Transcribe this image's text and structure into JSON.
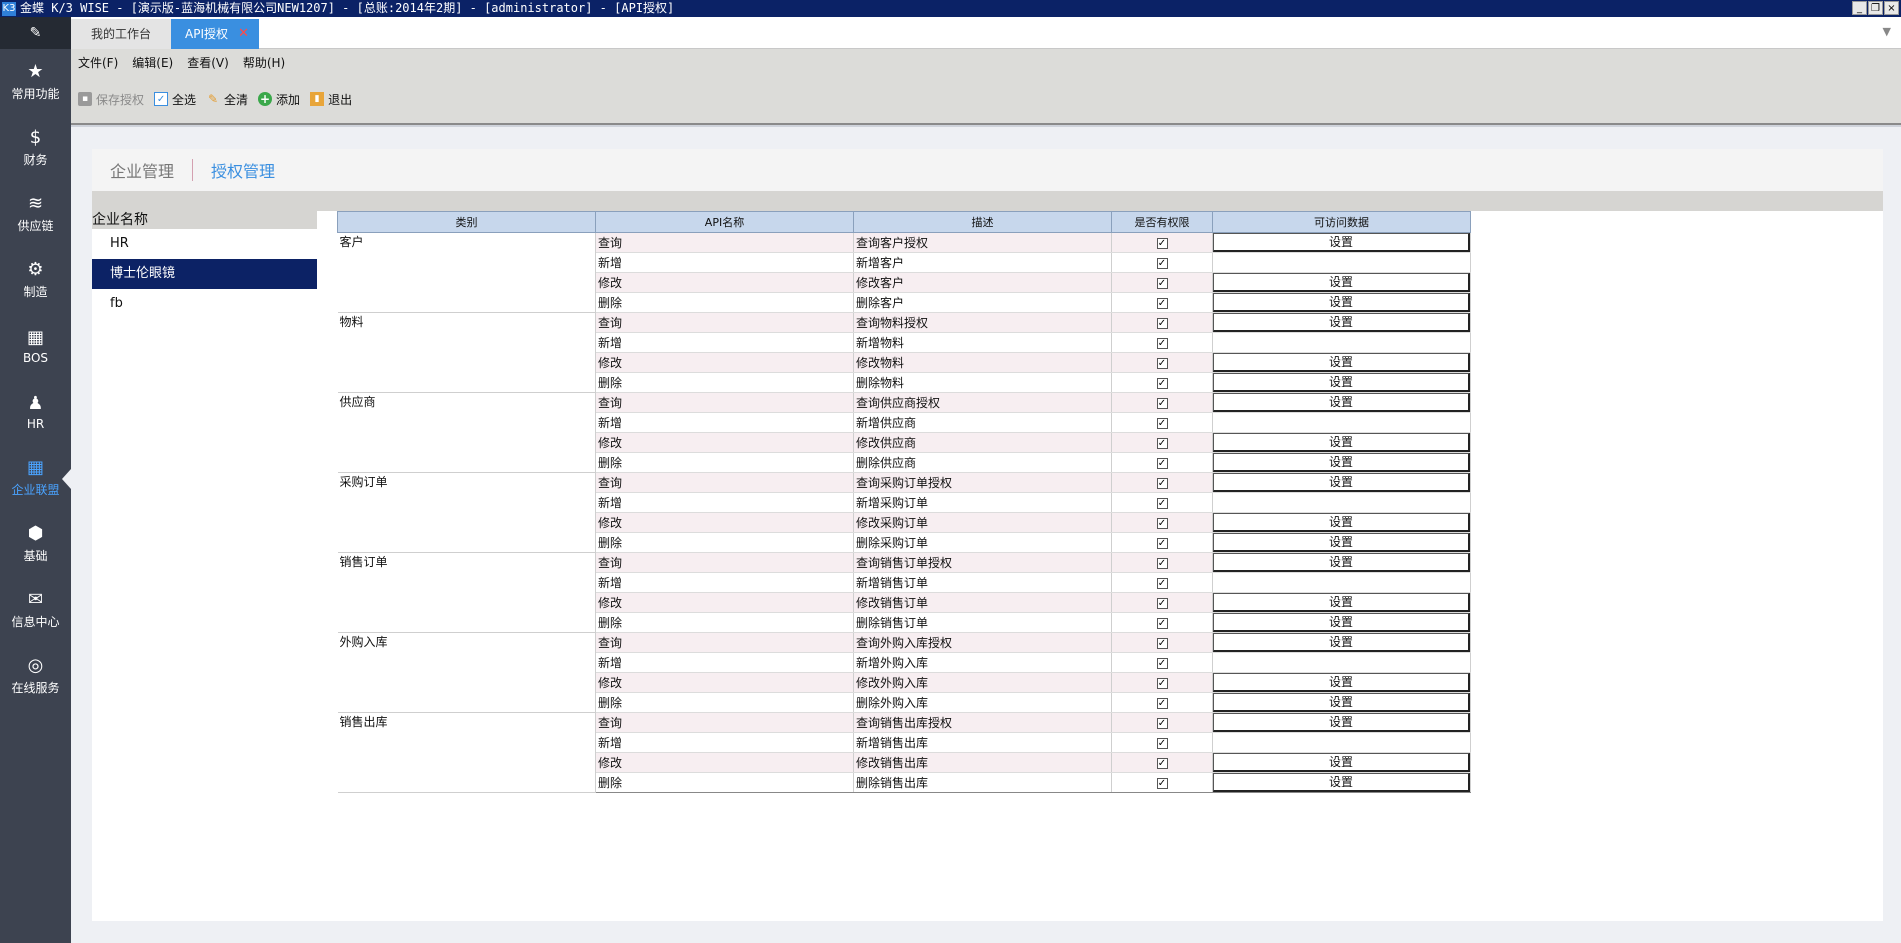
{
  "window": {
    "logo": "K3",
    "title": "金蝶 K/3 WISE - [演示版-蓝海机械有限公司NEW1207] - [总账:2014年2期] - [administrator] - [API授权]",
    "btn_min": "_",
    "btn_restore": "❐",
    "btn_close": "×"
  },
  "sidebar": {
    "edit_icon": "✎",
    "items": [
      {
        "label": "常用功能",
        "icon": "★",
        "icon_name": "star-icon"
      },
      {
        "label": "财务",
        "icon": "$",
        "icon_name": "dollar-icon"
      },
      {
        "label": "供应链",
        "icon": "≋",
        "icon_name": "database-icon"
      },
      {
        "label": "制造",
        "icon": "⚙",
        "icon_name": "gear-icon"
      },
      {
        "label": "BOS",
        "icon": "▦",
        "icon_name": "grid-icon"
      },
      {
        "label": "HR",
        "icon": "♟",
        "icon_name": "people-icon"
      },
      {
        "label": "企业联盟",
        "icon": "▦",
        "icon_name": "blocks-icon"
      },
      {
        "label": "基础",
        "icon": "⬢",
        "icon_name": "hexagon-icon"
      },
      {
        "label": "信息中心",
        "icon": "✉",
        "icon_name": "mail-icon"
      },
      {
        "label": "在线服务",
        "icon": "◎",
        "icon_name": "service-icon"
      }
    ],
    "active_index": 6
  },
  "tabs": {
    "workspace": "我的工作台",
    "active": "API授权",
    "close_glyph": "✕",
    "dropdown_glyph": "▼"
  },
  "menu": [
    "文件(F)",
    "编辑(E)",
    "查看(V)",
    "帮助(H)"
  ],
  "toolbar": {
    "save": "保存授权",
    "select_all": "全选",
    "clear_all": "全清",
    "add": "添加",
    "exit": "退出",
    "glyph_save": "▪",
    "glyph_select_all": "✓",
    "glyph_clear_all": "✎",
    "glyph_add": "+",
    "glyph_exit": "▮"
  },
  "subtabs": {
    "enterprise": "企业管理",
    "authorization": "授权管理"
  },
  "enterprise": {
    "title": "企业名称",
    "items": [
      "HR",
      "博士伦眼镜",
      "fb"
    ],
    "selected_index": 1
  },
  "grid": {
    "columns": [
      "类别",
      "API名称",
      "描述",
      "是否有权限",
      "可访问数据"
    ],
    "check_glyph": "✓",
    "button_label": "设置",
    "groups": [
      {
        "category": "客户",
        "rows": [
          {
            "api": "查询",
            "desc": "查询客户授权",
            "checked": true,
            "button": true
          },
          {
            "api": "新增",
            "desc": "新增客户",
            "checked": true,
            "button": false
          },
          {
            "api": "修改",
            "desc": "修改客户",
            "checked": true,
            "button": true
          },
          {
            "api": "删除",
            "desc": "删除客户",
            "checked": true,
            "button": true
          }
        ]
      },
      {
        "category": "物料",
        "rows": [
          {
            "api": "查询",
            "desc": "查询物料授权",
            "checked": true,
            "button": true
          },
          {
            "api": "新增",
            "desc": "新增物料",
            "checked": true,
            "button": false
          },
          {
            "api": "修改",
            "desc": "修改物料",
            "checked": true,
            "button": true
          },
          {
            "api": "删除",
            "desc": "删除物料",
            "checked": true,
            "button": true
          }
        ]
      },
      {
        "category": "供应商",
        "rows": [
          {
            "api": "查询",
            "desc": "查询供应商授权",
            "checked": true,
            "button": true
          },
          {
            "api": "新增",
            "desc": "新增供应商",
            "checked": true,
            "button": false
          },
          {
            "api": "修改",
            "desc": "修改供应商",
            "checked": true,
            "button": true
          },
          {
            "api": "删除",
            "desc": "删除供应商",
            "checked": true,
            "button": true
          }
        ]
      },
      {
        "category": "采购订单",
        "rows": [
          {
            "api": "查询",
            "desc": "查询采购订单授权",
            "checked": true,
            "button": true
          },
          {
            "api": "新增",
            "desc": "新增采购订单",
            "checked": true,
            "button": false
          },
          {
            "api": "修改",
            "desc": "修改采购订单",
            "checked": true,
            "button": true
          },
          {
            "api": "删除",
            "desc": "删除采购订单",
            "checked": true,
            "button": true
          }
        ]
      },
      {
        "category": "销售订单",
        "rows": [
          {
            "api": "查询",
            "desc": "查询销售订单授权",
            "checked": true,
            "button": true
          },
          {
            "api": "新增",
            "desc": "新增销售订单",
            "checked": true,
            "button": false
          },
          {
            "api": "修改",
            "desc": "修改销售订单",
            "checked": true,
            "button": true
          },
          {
            "api": "删除",
            "desc": "删除销售订单",
            "checked": true,
            "button": true
          }
        ]
      },
      {
        "category": "外购入库",
        "rows": [
          {
            "api": "查询",
            "desc": "查询外购入库授权",
            "checked": true,
            "button": true
          },
          {
            "api": "新增",
            "desc": "新增外购入库",
            "checked": true,
            "button": false
          },
          {
            "api": "修改",
            "desc": "修改外购入库",
            "checked": true,
            "button": true
          },
          {
            "api": "删除",
            "desc": "删除外购入库",
            "checked": true,
            "button": true
          }
        ]
      },
      {
        "category": "销售出库",
        "rows": [
          {
            "api": "查询",
            "desc": "查询销售出库授权",
            "checked": true,
            "button": true
          },
          {
            "api": "新增",
            "desc": "新增销售出库",
            "checked": true,
            "button": false
          },
          {
            "api": "修改",
            "desc": "修改销售出库",
            "checked": true,
            "button": true
          },
          {
            "api": "删除",
            "desc": "删除销售出库",
            "checked": true,
            "button": true
          }
        ]
      }
    ]
  },
  "colors": {
    "title_bar": "#0b2266",
    "sidebar": "#3d4350",
    "accent": "#3a8fe0",
    "selected_row": "#0c2265",
    "grid_header": "#c7d7ec"
  }
}
